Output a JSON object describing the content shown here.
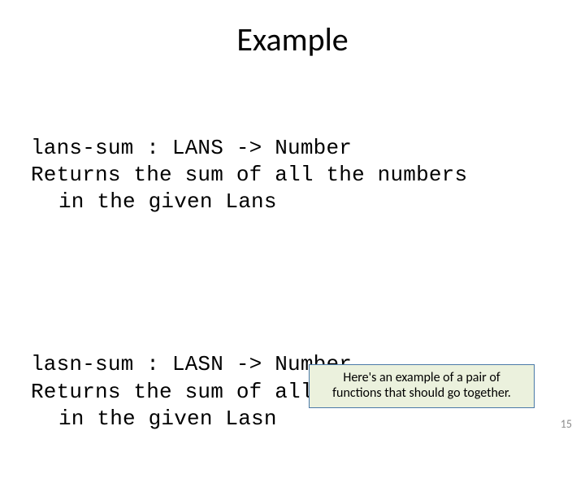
{
  "title": "Example",
  "block1": {
    "signature": "lans-sum : LANS -> Number",
    "desc_line1": "Returns the sum of all the numbers",
    "desc_line2": "in the given Lans"
  },
  "block2": {
    "signature": "lasn-sum : LASN -> Number",
    "desc_line1": "Returns the sum of all the numbers",
    "desc_line2": "in the given Lasn"
  },
  "callout": {
    "line1": "Here's an example of a pair of",
    "line2": "functions that should go together."
  },
  "page_number": "15"
}
